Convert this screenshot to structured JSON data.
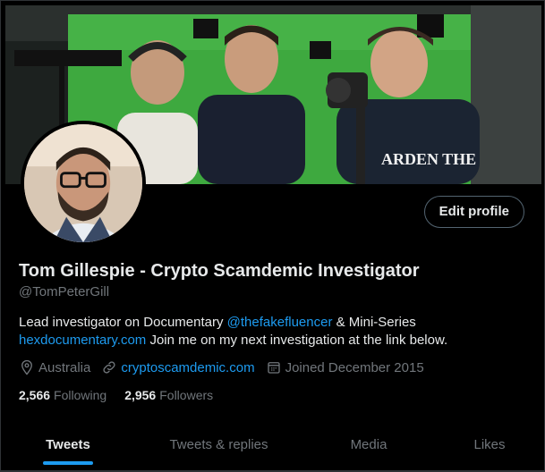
{
  "profile": {
    "name": "Tom Gillespie - Crypto Scamdemic Investigator",
    "handle": "@TomPeterGill",
    "edit_label": "Edit profile"
  },
  "bio": {
    "part1": "Lead investigator on Documentary ",
    "mention": "@thefakefluencer",
    "part2": " & Mini-Series ",
    "link": "hexdocumentary.com",
    "part3": " Join me on my next investigation at the link below."
  },
  "meta": {
    "location": "Australia",
    "url": "cryptoscamdemic.com",
    "joined": "Joined December 2015"
  },
  "stats": {
    "following_count": "2,566",
    "following_label": "Following",
    "followers_count": "2,956",
    "followers_label": "Followers"
  },
  "tabs": [
    {
      "label": "Tweets",
      "active": true
    },
    {
      "label": "Tweets & replies",
      "active": false
    },
    {
      "label": "Media",
      "active": false
    },
    {
      "label": "Likes",
      "active": false
    }
  ],
  "banner_text": "ARDEN THE",
  "colors": {
    "background": "#000000",
    "primary_text": "#e7e9ea",
    "secondary_text": "#71767b",
    "accent": "#1d9bf0"
  }
}
